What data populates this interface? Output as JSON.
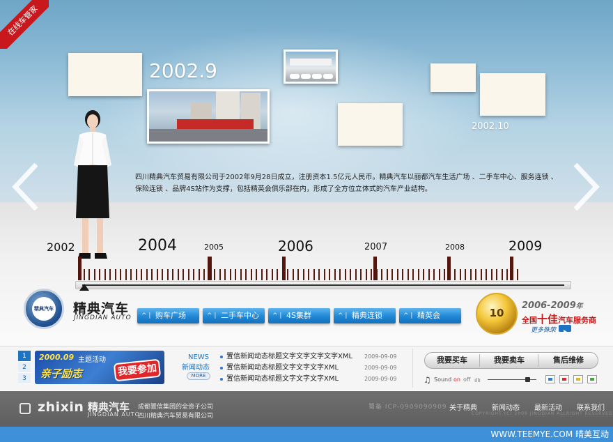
{
  "corner_ribbon": {
    "label": "在线车管家"
  },
  "hero": {
    "year_left": "2002.9",
    "year_right": "2002.10",
    "description": "四川精典汽车贸易有限公司于2002年9月28日成立，注册资本1.5亿元人民币。精典汽车以丽都汽车生活广场 、二手车中心、服务连锁 、保险连锁 、品牌4S站作为支撑，包括精英会俱乐部在内，形成了全方位立体式的汽车产业结构。"
  },
  "timeline": {
    "labels": [
      "2002",
      "2004",
      "2005",
      "2006",
      "2007",
      "2008",
      "2009"
    ],
    "current_position": 0
  },
  "brand": {
    "name_cn": "精典汽车",
    "name_en": "JINGDIAN AUTO",
    "logo_text": "精典汽车"
  },
  "nav": {
    "items": [
      {
        "label": "购车广场"
      },
      {
        "label": "二手车中心"
      },
      {
        "label": "4S集群"
      },
      {
        "label": "精典连锁"
      },
      {
        "label": "精英会"
      }
    ]
  },
  "award": {
    "badge": "10",
    "years": "2006-2009",
    "years_suffix": "年",
    "title_pre": "全国",
    "title_em": "十佳",
    "title_post": "汽车服务商",
    "more": "更多殊荣"
  },
  "promo": {
    "tabs": [
      "1",
      "2",
      "3"
    ],
    "active_tab": 0,
    "date": "2000.09",
    "theme": "主题活动",
    "main": "亲子励志",
    "cta": "我要参加"
  },
  "news": {
    "head": "NEWS",
    "sub": "新闻动态",
    "more": "MORE",
    "items": [
      {
        "title": "置信新闻动态标题文字文字文字文字XML",
        "date": "2009-09-09"
      },
      {
        "title": "置信新闻动态标题文字文字文字XML",
        "date": "2009-09-09"
      },
      {
        "title": "置信新闻动态标题文字文字文字XML",
        "date": "2009-09-09"
      }
    ]
  },
  "actions": {
    "buy": "我要买车",
    "sell": "我要卖车",
    "service": "售后维修"
  },
  "sound": {
    "label": "Sound",
    "on": "on",
    "off": "off",
    "skin_colors": [
      "#2d7fd4",
      "#d42b2b",
      "#e3b21c",
      "#3fa83f"
    ]
  },
  "footer": {
    "zhixin": "zhixin",
    "brand_cn": "精典汽车",
    "brand_en": "JINGDIAN AUTO",
    "line1": "成都置信集团的全资子公司",
    "line2": "四川精典汽车贸易有限公司",
    "icp": "蜀备 ICP-0909090909",
    "copyright": "COPYRIGHT (C) 2009 JINGDIAN ALLRIGHT RESERVED",
    "links": [
      "关于精典",
      "新闻动态",
      "最新活动",
      "联系我们"
    ]
  },
  "strip": {
    "text": "WWW.TEEMYE.COM  晴美互动"
  },
  "colors": {
    "accent": "#1d74c2",
    "timeline_tick": "#52160f",
    "ribbon": "#c9171e"
  }
}
